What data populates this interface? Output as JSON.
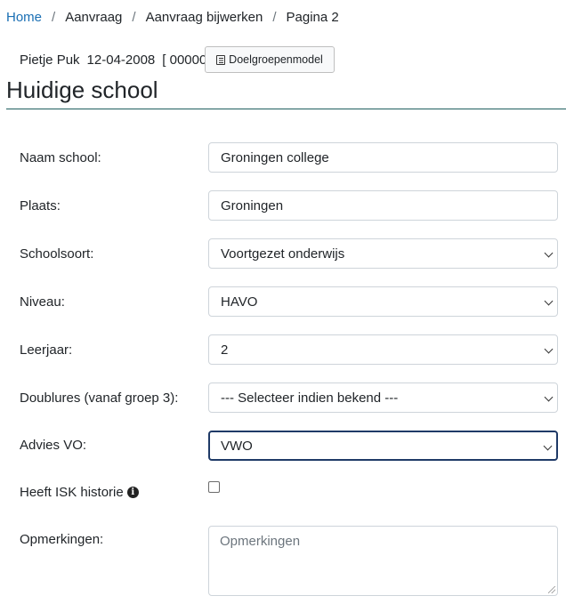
{
  "breadcrumb": {
    "home": "Home",
    "items": [
      "Aanvraag",
      "Aanvraag bijwerken",
      "Pagina 2"
    ],
    "separator": "/"
  },
  "patient": {
    "name": "Pietje Puk",
    "dob": "12-04-2008",
    "id": "[ 00000 ]",
    "button_label": "Doelgroepenmodel",
    "button_icon": "list-alt-icon"
  },
  "page": {
    "title": "Huidige school"
  },
  "form": {
    "naam_school": {
      "label": "Naam school:",
      "value": "Groningen college"
    },
    "plaats": {
      "label": "Plaats:",
      "value": "Groningen"
    },
    "schoolsoort": {
      "label": "Schoolsoort:",
      "value": "Voortgezet onderwijs"
    },
    "niveau": {
      "label": "Niveau:",
      "value": "HAVO"
    },
    "leerjaar": {
      "label": "Leerjaar:",
      "value": "2"
    },
    "doublures": {
      "label": "Doublures (vanaf groep 3):",
      "value": "--- Selecteer indien bekend ---"
    },
    "advies_vo": {
      "label": "Advies VO:",
      "value": "VWO"
    },
    "isk_historie": {
      "label": "Heeft ISK historie",
      "checked": false,
      "icon": "info-circle-icon"
    },
    "opmerkingen": {
      "label": "Opmerkingen:",
      "value": "",
      "placeholder": "Opmerkingen"
    }
  },
  "colors": {
    "link": "#1a6fb4",
    "rule": "#1f5e5e",
    "focus": "#1f3a67"
  }
}
